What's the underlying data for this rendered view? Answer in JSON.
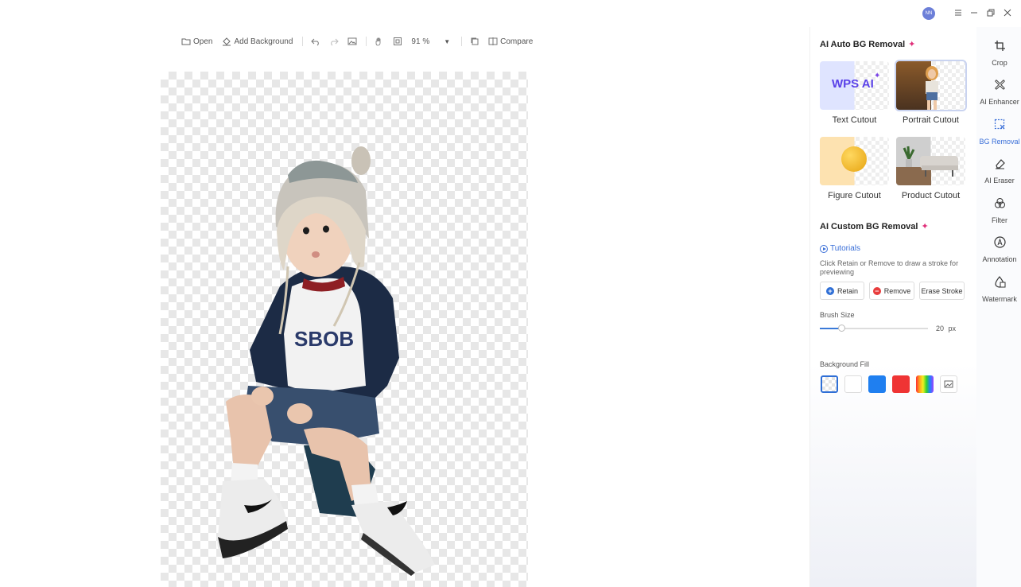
{
  "titlebar": {
    "avatar_initials": "NN"
  },
  "toolbar": {
    "open_label": "Open",
    "add_background_label": "Add Background",
    "zoom": "91 %",
    "compare_label": "Compare"
  },
  "panel": {
    "auto_title": "AI Auto BG Removal",
    "cards": [
      {
        "label": "Text Cutout",
        "thumb_text": "WPS AI"
      },
      {
        "label": "Portrait Cutout"
      },
      {
        "label": "Figure Cutout"
      },
      {
        "label": "Product Cutout"
      }
    ],
    "custom_title": "AI Custom BG Removal",
    "tutorials": "Tutorials",
    "hint": "Click Retain or Remove to draw a stroke for previewing",
    "retain": "Retain",
    "remove": "Remove",
    "erase_stroke": "Erase Stroke",
    "brush_size_label": "Brush Size",
    "brush_size_value": "20",
    "brush_size_unit": "px",
    "brush_size_fraction": 0.2,
    "background_fill_label": "Background Fill",
    "fills": [
      "transparent",
      "#ffffff",
      "#1f7ff0",
      "#ef3434",
      "rainbow"
    ]
  },
  "rail": [
    {
      "label": "Crop",
      "icon": "crop-icon"
    },
    {
      "label": "AI Enhancer",
      "icon": "enhancer-icon"
    },
    {
      "label": "BG Removal",
      "icon": "bg-removal-icon",
      "active": true
    },
    {
      "label": "AI Eraser",
      "icon": "eraser-icon"
    },
    {
      "label": "Filter",
      "icon": "filter-icon"
    },
    {
      "label": "Annotation",
      "icon": "annotation-icon"
    },
    {
      "label": "Watermark",
      "icon": "watermark-icon"
    }
  ],
  "colors": {
    "accent": "#3a6fd8",
    "spark": "#e0307a"
  }
}
